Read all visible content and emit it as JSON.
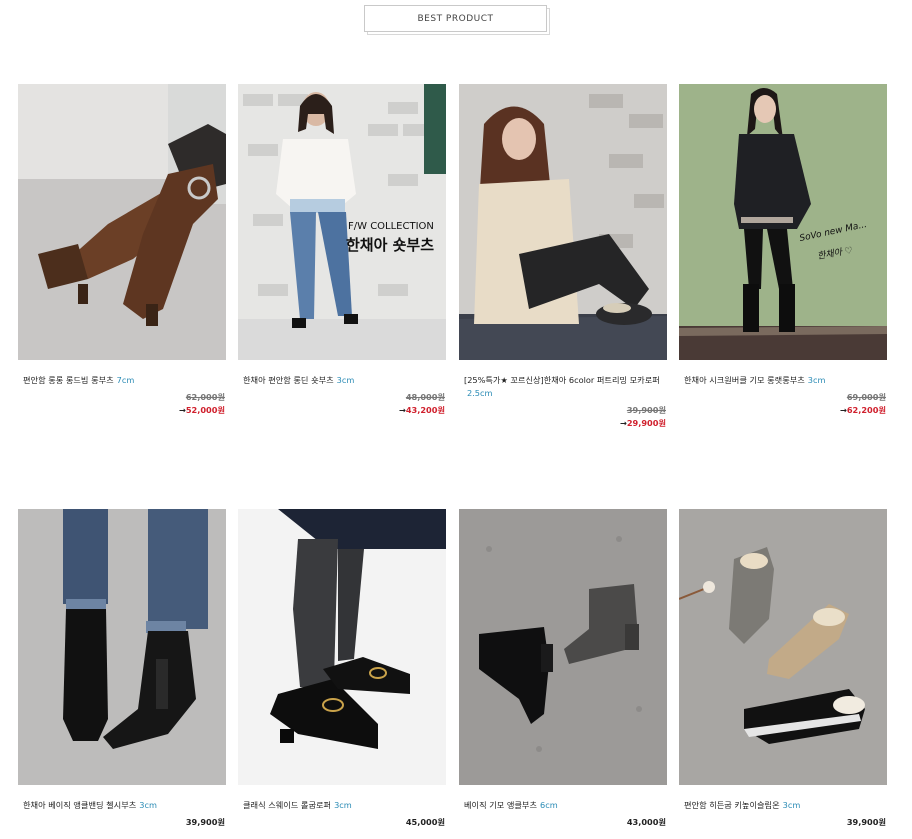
{
  "section_tab": {
    "label": "BEST PRODUCT"
  },
  "overlays": {
    "p2_line1": "F/W COLLECTION",
    "p2_line2": "한채아 숏부츠",
    "p4_sig1": "SoVo new Ma...",
    "p4_sig2": "한채아 ♡"
  },
  "products": [
    {
      "name": "편안함 롱롱 롱드빔 롱부츠",
      "heel": "7cm",
      "old_price": "62,000원",
      "arrow": "→",
      "price": "52,000원"
    },
    {
      "name": "한채아 편안함 롱딘 숏부츠",
      "heel": "3cm",
      "old_price": "48,000원",
      "arrow": "→",
      "price": "43,200원"
    },
    {
      "name": "[25%특가★ 꼬르신상]한채아 6color 퍼트리밍 모카로퍼",
      "heel": "2.5cm",
      "old_price": "39,900원",
      "arrow": "→",
      "price": "29,900원"
    },
    {
      "name": "한채아 시크원버클 기모 롱랫롱부츠",
      "heel": "3cm",
      "old_price": "69,000원",
      "arrow": "→",
      "price": "62,200원"
    },
    {
      "name": "한채아 베이직 앵클밴딩 첼시부츠",
      "heel": "3cm",
      "price": "39,900원"
    },
    {
      "name": "클래식 스웨이드 롤굽로퍼",
      "heel": "3cm",
      "price": "45,000원"
    },
    {
      "name": "베이직 기모 앵클부츠",
      "heel": "6cm",
      "price": "43,000원"
    },
    {
      "name": "편안함 히든굽 키높이슬립온",
      "heel": "3cm",
      "price": "39,900원"
    }
  ]
}
